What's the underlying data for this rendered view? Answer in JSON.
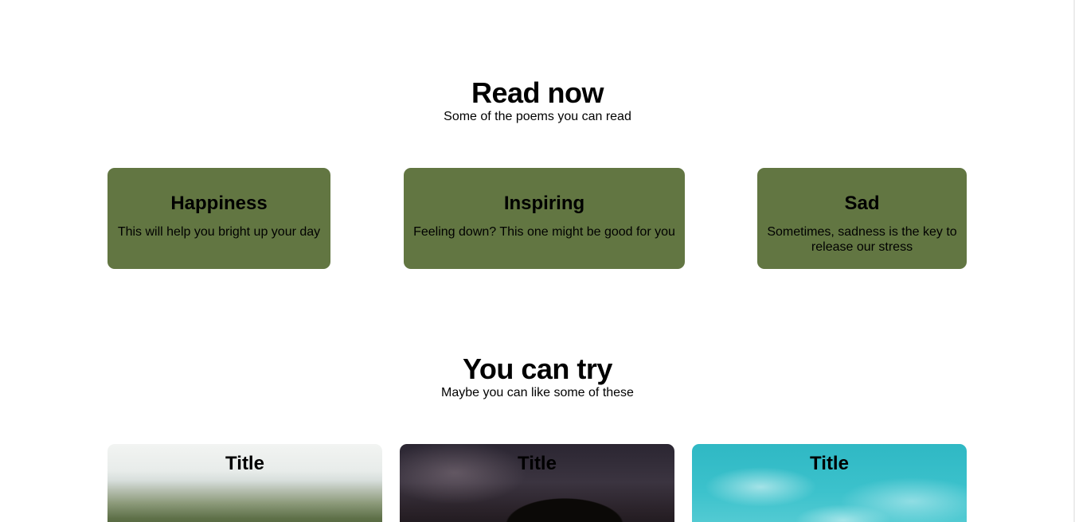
{
  "read_now": {
    "title": "Read now",
    "subtitle": "Some of the poems you can read",
    "cards": [
      {
        "title": "Happiness",
        "description": "This will help you bright up your day"
      },
      {
        "title": "Inspiring",
        "description": "Feeling down? This one might be good for you"
      },
      {
        "title": "Sad",
        "description": "Sometimes, sadness is the key to release our stress"
      }
    ]
  },
  "you_can_try": {
    "title": "You can try",
    "subtitle": "Maybe you can like some of these",
    "cards": [
      {
        "title": "Title",
        "image": "landscape-image"
      },
      {
        "title": "Title",
        "image": "starry-sky-image"
      },
      {
        "title": "Title",
        "image": "turquoise-sky-image"
      }
    ]
  },
  "colors": {
    "category_card_bg": "#627642",
    "page_bg": "#ffffff",
    "text": "#000000"
  }
}
